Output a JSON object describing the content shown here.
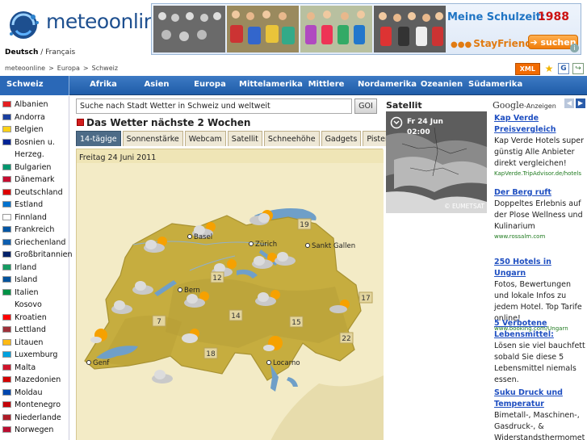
{
  "header": {
    "logo_text": "meteoonline",
    "language_active": "Deutsch",
    "language_sep": " / ",
    "language_other": "Français"
  },
  "banner": {
    "title": "Meine Schulzeit:",
    "year": "1988",
    "brand": "StayFriends",
    "search_label": "suchen",
    "info_icon": "i"
  },
  "breadcrumb": [
    "meteoonline",
    "Europa",
    "Schweiz"
  ],
  "tools": {
    "xml_label": "XML"
  },
  "nav": {
    "home": "Schweiz",
    "items": [
      "Afrika",
      "Asien",
      "Europa",
      "Mittelamerika",
      "Mittlere Osten",
      "Nordamerika",
      "Ozeanien",
      "Südamerika"
    ]
  },
  "countries": [
    {
      "name": "Albanien",
      "flag": "#e41e20"
    },
    {
      "name": "Andorra",
      "flag": "#1a3f9f"
    },
    {
      "name": "Belgien",
      "flag": "#fcd116"
    },
    {
      "name": "Bosnien u.",
      "flag": "#002395"
    },
    {
      "name": "Herzeg.",
      "flag": ""
    },
    {
      "name": "Bulgarien",
      "flag": "#00966e"
    },
    {
      "name": "Dänemark",
      "flag": "#c60c30"
    },
    {
      "name": "Deutschland",
      "flag": "#dd0000"
    },
    {
      "name": "Estland",
      "flag": "#0072ce"
    },
    {
      "name": "Finnland",
      "flag": "#ffffff"
    },
    {
      "name": "Frankreich",
      "flag": "#0055a4"
    },
    {
      "name": "Griechenland",
      "flag": "#0d5eaf"
    },
    {
      "name": "Großbritannien",
      "flag": "#012169"
    },
    {
      "name": "Irland",
      "flag": "#169b62"
    },
    {
      "name": "Island",
      "flag": "#02529c"
    },
    {
      "name": "Italien",
      "flag": "#009246"
    },
    {
      "name": "Kosovo",
      "flag": ""
    },
    {
      "name": "Kroatien",
      "flag": "#ff0000"
    },
    {
      "name": "Lettland",
      "flag": "#9e3039"
    },
    {
      "name": "Litauen",
      "flag": "#fdb913"
    },
    {
      "name": "Luxemburg",
      "flag": "#00a1de"
    },
    {
      "name": "Malta",
      "flag": "#cf142b"
    },
    {
      "name": "Mazedonien",
      "flag": "#d20000"
    },
    {
      "name": "Moldau",
      "flag": "#0046ae"
    },
    {
      "name": "Montenegro",
      "flag": "#c40308"
    },
    {
      "name": "Niederlande",
      "flag": "#ae1c28"
    },
    {
      "name": "Norwegen",
      "flag": "#ba0c2f"
    }
  ],
  "search": {
    "value": "Suche nach Stadt Wetter in Schweiz und weltweit",
    "button": "GOI"
  },
  "section_title": "Das Wetter nächste 2 Wochen",
  "tabs": [
    "14-tägige",
    "Sonnenstärke",
    "Webcam",
    "Satellit",
    "Schneehöhe",
    "Gadgets",
    "Pisten-Infos"
  ],
  "map": {
    "date": "Freitag 24 Juni 2011",
    "cities": [
      "Basel",
      "Zürich",
      "Sankt Gallen",
      "Bern",
      "Genf",
      "Locarno"
    ],
    "temperatures": [
      "19",
      "12",
      "14",
      "7",
      "15",
      "17",
      "22",
      "18"
    ]
  },
  "satellite": {
    "title": "Satellit",
    "date_line1": "Fr 24 Jun",
    "date_line2": "02:00",
    "credit": "© EUMETSAT"
  },
  "ads": {
    "brand": "Google",
    "label": "-Anzeigen",
    "items": [
      {
        "title": "Kap Verde Preisvergleich",
        "body": "Kap Verde Hotels super günstig Alle Anbieter direkt vergleichen!",
        "url": "KapVerde.TripAdvisor.de/hotels"
      },
      {
        "title": "Der Berg ruft",
        "body": "Doppeltes Erlebnis auf der Plose Wellness und Kulinarium",
        "url": "www.rossalm.com"
      },
      {
        "title": "250 Hotels in Ungarn",
        "body": "Fotos, Bewertungen und lokale Infos zu jedem Hotel. Top Tarife online!",
        "url": "www.booking.com/Ungarn"
      },
      {
        "title": "5 Verbotene Lebensmittel:",
        "body": "Lösen sie viel bauchfett sobald Sie diese 5 Lebensmittel niemals essen.",
        "url": ""
      },
      {
        "title": "Suku Druck und Temperatur",
        "body": "Bimetall-, Maschinen-, Gasdruck-, & Widerstandsthermometer",
        "url": ""
      }
    ]
  }
}
